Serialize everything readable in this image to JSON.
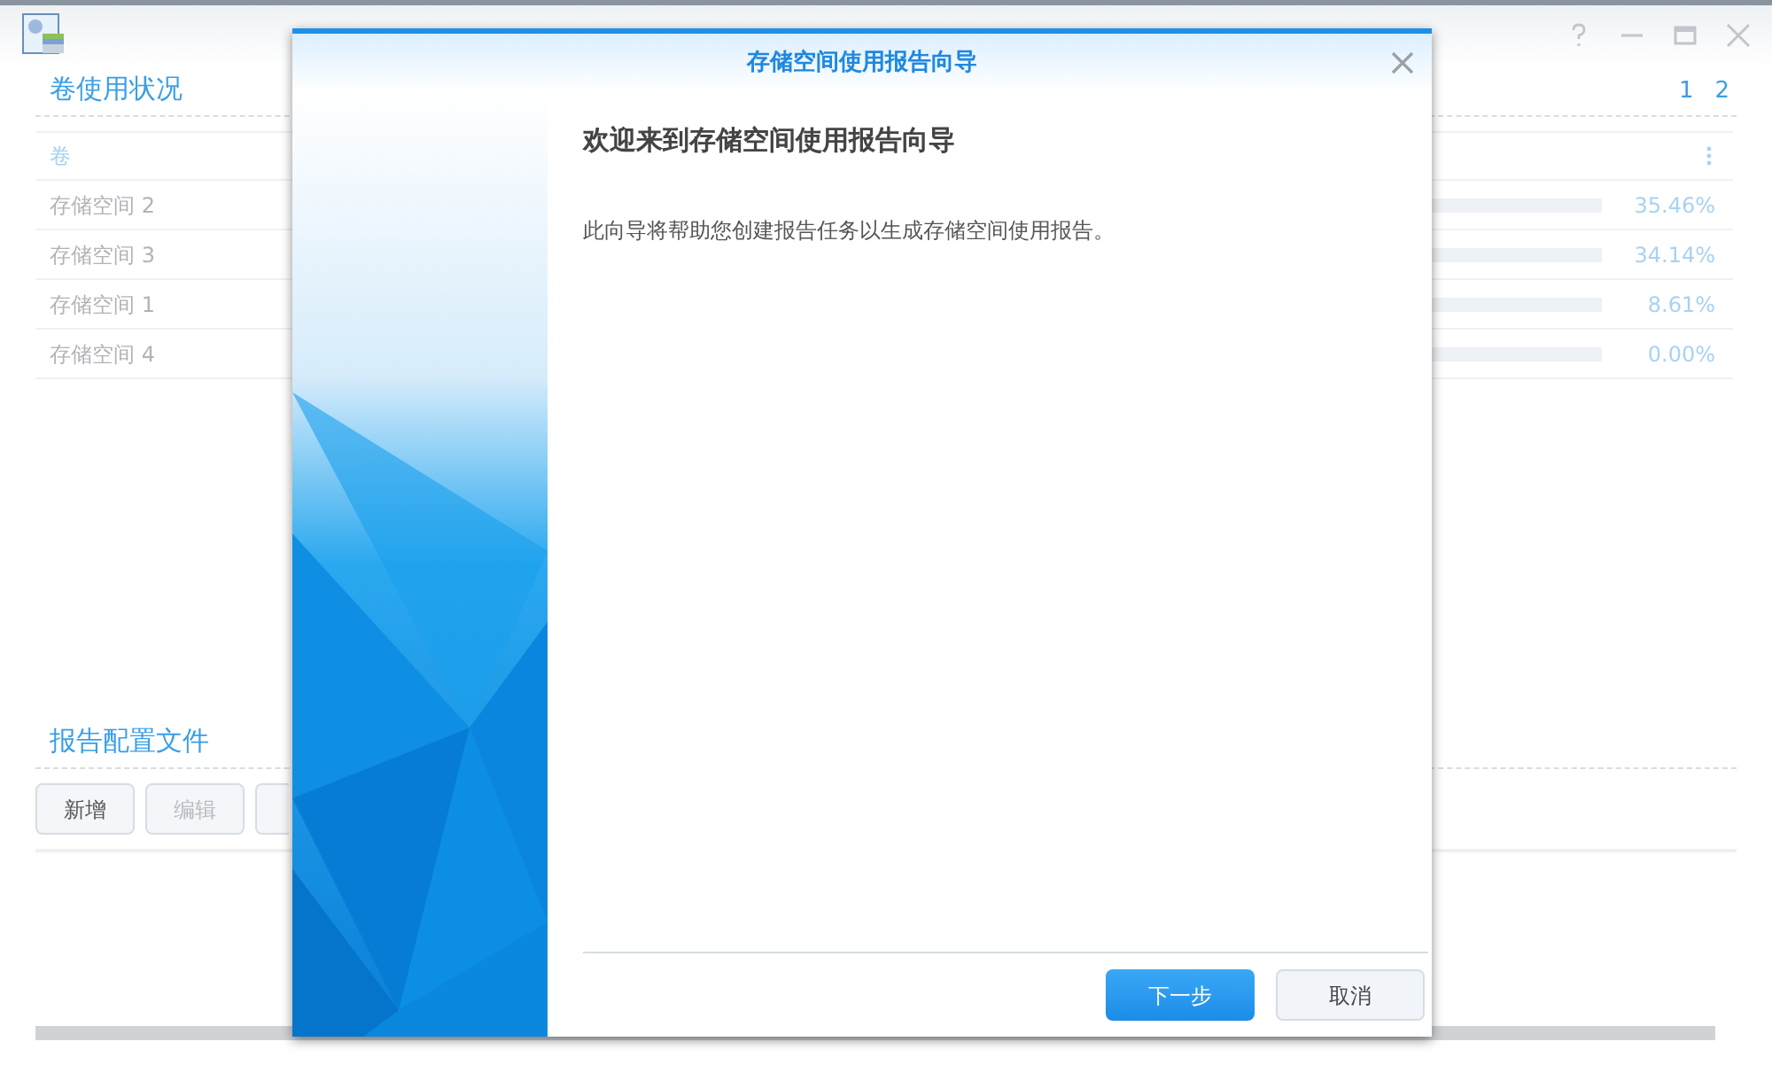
{
  "volume_usage": {
    "title": "卷使用状况",
    "pages": [
      {
        "label": "1",
        "selected": false
      },
      {
        "label": "2",
        "selected": false
      }
    ],
    "column_1": "卷",
    "rows": [
      {
        "name": "存储空间 2",
        "percent": "35.46%"
      },
      {
        "name": "存储空间 3",
        "percent": "34.14%"
      },
      {
        "name": "存储空间 1",
        "percent": "8.61%"
      },
      {
        "name": "存储空间 4",
        "percent": "0.00%"
      }
    ]
  },
  "report_profiles": {
    "title": "报告配置文件",
    "buttons": [
      {
        "label": "新增",
        "disabled": false
      },
      {
        "label": "编辑",
        "disabled": true
      }
    ]
  },
  "dialog": {
    "title": "存储空间使用报告向导",
    "heading": "欢迎来到存储空间使用报告向导",
    "description": "此向导将帮助您创建报告任务以生成存储空间使用报告。",
    "buttons": [
      {
        "label": "下一步",
        "kind": "primary"
      },
      {
        "label": "取消",
        "kind": "secondary"
      }
    ]
  }
}
